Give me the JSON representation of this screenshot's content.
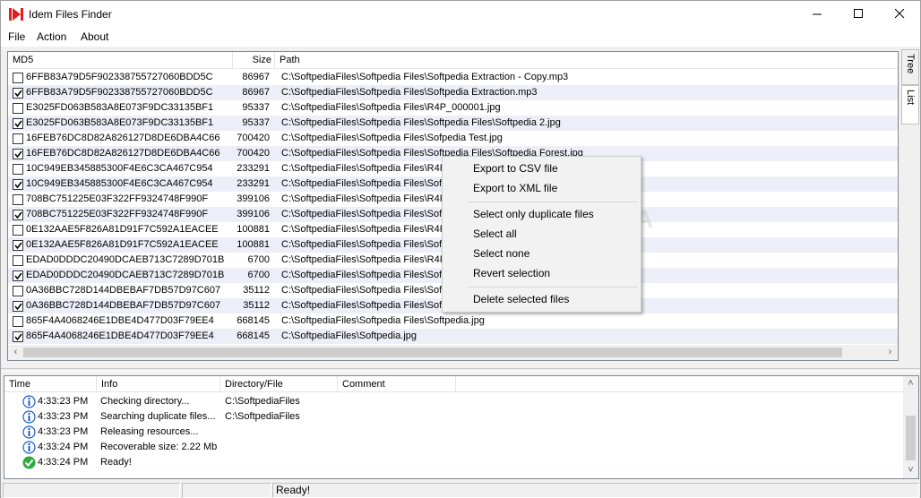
{
  "window": {
    "title": "Idem Files Finder",
    "minimize_glyph": "—",
    "close_glyph": "✕"
  },
  "menu": {
    "file": "File",
    "action": "Action",
    "about": "About"
  },
  "file_list": {
    "columns": {
      "md5": "MD5",
      "size": "Size",
      "path": "Path"
    },
    "rows": [
      {
        "checked": false,
        "md5": "6FFB83A79D5F902338755727060BDD5C",
        "size": "86967",
        "path": "C:\\SoftpediaFiles\\Softpedia Files\\Softpedia Extraction - Copy.mp3"
      },
      {
        "checked": true,
        "md5": "6FFB83A79D5F902338755727060BDD5C",
        "size": "86967",
        "path": "C:\\SoftpediaFiles\\Softpedia Files\\Softpedia Extraction.mp3"
      },
      {
        "checked": false,
        "md5": "E3025FD063B583A8E073F9DC33135BF1",
        "size": "95337",
        "path": "C:\\SoftpediaFiles\\Softpedia Files\\R4P_000001.jpg"
      },
      {
        "checked": true,
        "md5": "E3025FD063B583A8E073F9DC33135BF1",
        "size": "95337",
        "path": "C:\\SoftpediaFiles\\Softpedia Files\\Softpedia Files\\Softpedia 2.jpg"
      },
      {
        "checked": false,
        "md5": "16FEB76DC8D82A826127D8DE6DBA4C66",
        "size": "700420",
        "path": "C:\\SoftpediaFiles\\Softpedia Files\\Sofpedia Test.jpg"
      },
      {
        "checked": true,
        "md5": "16FEB76DC8D82A826127D8DE6DBA4C66",
        "size": "700420",
        "path": "C:\\SoftpediaFiles\\Softpedia Files\\Softpedia Files\\Softpedia Forest.jpg"
      },
      {
        "checked": false,
        "md5": "10C949EB345885300F4E6C3CA467C954",
        "size": "233291",
        "path": "C:\\SoftpediaFiles\\Softpedia Files\\R4P"
      },
      {
        "checked": true,
        "md5": "10C949EB345885300F4E6C3CA467C954",
        "size": "233291",
        "path": "C:\\SoftpediaFiles\\Softpedia Files\\Soft"
      },
      {
        "checked": false,
        "md5": "708BC751225E03F322FF9324748F990F",
        "size": "399106",
        "path": "C:\\SoftpediaFiles\\Softpedia Files\\R4P"
      },
      {
        "checked": true,
        "md5": "708BC751225E03F322FF9324748F990F",
        "size": "399106",
        "path": "C:\\SoftpediaFiles\\Softpedia Files\\Soft"
      },
      {
        "checked": false,
        "md5": "0E132AAE5F826A81D91F7C592A1EACEE",
        "size": "100881",
        "path": "C:\\SoftpediaFiles\\Softpedia Files\\R4P"
      },
      {
        "checked": true,
        "md5": "0E132AAE5F826A81D91F7C592A1EACEE",
        "size": "100881",
        "path": "C:\\SoftpediaFiles\\Softpedia Files\\Soft"
      },
      {
        "checked": false,
        "md5": "EDAD0DDDC20490DCAEB713C7289D701B",
        "size": "6700",
        "path": "C:\\SoftpediaFiles\\Softpedia Files\\R4P"
      },
      {
        "checked": true,
        "md5": "EDAD0DDDC20490DCAEB713C7289D701B",
        "size": "6700",
        "path": "C:\\SoftpediaFiles\\Softpedia Files\\Soft"
      },
      {
        "checked": false,
        "md5": "0A36BBC728D144DBEBAF7DB57D97C607",
        "size": "35112",
        "path": "C:\\SoftpediaFiles\\Softpedia Files\\Soft"
      },
      {
        "checked": true,
        "md5": "0A36BBC728D144DBEBAF7DB57D97C607",
        "size": "35112",
        "path": "C:\\SoftpediaFiles\\Softpedia Files\\Soft"
      },
      {
        "checked": false,
        "md5": "865F4A4068246E1DBE4D477D03F79EE4",
        "size": "668145",
        "path": "C:\\SoftpediaFiles\\Softpedia Files\\Softpedia.jpg"
      },
      {
        "checked": true,
        "md5": "865F4A4068246E1DBE4D477D03F79EE4",
        "size": "668145",
        "path": "C:\\SoftpediaFiles\\Softpedia.jpg"
      }
    ]
  },
  "side_tabs": {
    "tree": "Tree",
    "list": "List"
  },
  "context_menu": {
    "export_csv": "Export to CSV file",
    "export_xml": "Export to XML file",
    "select_duplicates": "Select only duplicate files",
    "select_all": "Select all",
    "select_none": "Select none",
    "revert_selection": "Revert selection",
    "delete_selected": "Delete selected files"
  },
  "log": {
    "columns": {
      "time": "Time",
      "info": "Info",
      "dir": "Directory/File",
      "comment": "Comment"
    },
    "rows": [
      {
        "icon": "info-icon",
        "time": "4:33:23 PM",
        "info": "Checking directory...",
        "dir": "C:\\SoftpediaFiles"
      },
      {
        "icon": "info-icon",
        "time": "4:33:23 PM",
        "info": "Searching duplicate files...",
        "dir": "C:\\SoftpediaFiles"
      },
      {
        "icon": "info-icon",
        "time": "4:33:23 PM",
        "info": "Releasing resources...",
        "dir": ""
      },
      {
        "icon": "info-icon",
        "time": "4:33:24 PM",
        "info": "Recoverable size: 2.22 Mb",
        "dir": ""
      },
      {
        "icon": "check-icon",
        "time": "4:33:24 PM",
        "info": "Ready!",
        "dir": ""
      }
    ]
  },
  "status": {
    "panel1": "",
    "panel2": "",
    "panel3": "Ready!"
  },
  "colors": {
    "app_icon": "#e02020",
    "alt_row": "#eeeef8",
    "ok_green": "#2eaa3a",
    "info_blue": "#1e5bc6"
  }
}
